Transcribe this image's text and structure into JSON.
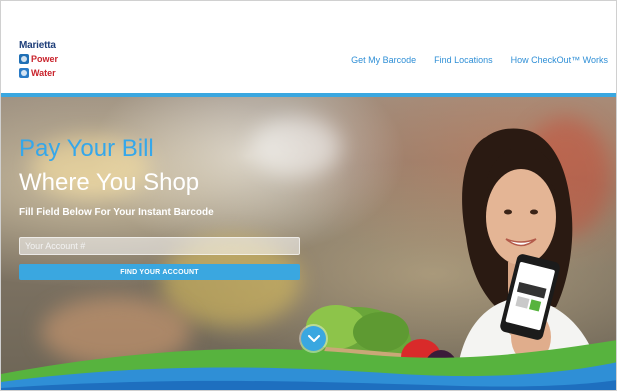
{
  "header": {
    "logo": {
      "line1": "Marietta",
      "line2": "Power",
      "line3": "Water"
    },
    "nav": [
      {
        "label": "Get My Barcode"
      },
      {
        "label": "Find Locations"
      },
      {
        "label": "How CheckOut™ Works"
      }
    ]
  },
  "hero": {
    "headline_line1": "Pay Your Bill",
    "headline_line2": "Where You Shop",
    "subheading": "Fill Field Below For Your Instant Barcode",
    "account_input": {
      "placeholder": "Your Account #",
      "value": ""
    },
    "find_button_label": "FIND YOUR ACCOUNT"
  },
  "icons": {
    "scroll_down": "chevron-down-icon",
    "power_badge": "lightning-icon",
    "water_badge": "water-drop-icon"
  },
  "colors": {
    "accent": "#3aa7e0",
    "brand_navy": "#1f3f7a",
    "brand_red": "#c9232c",
    "headline_blue": "#35a7ea",
    "grass_green": "#57b33e"
  }
}
